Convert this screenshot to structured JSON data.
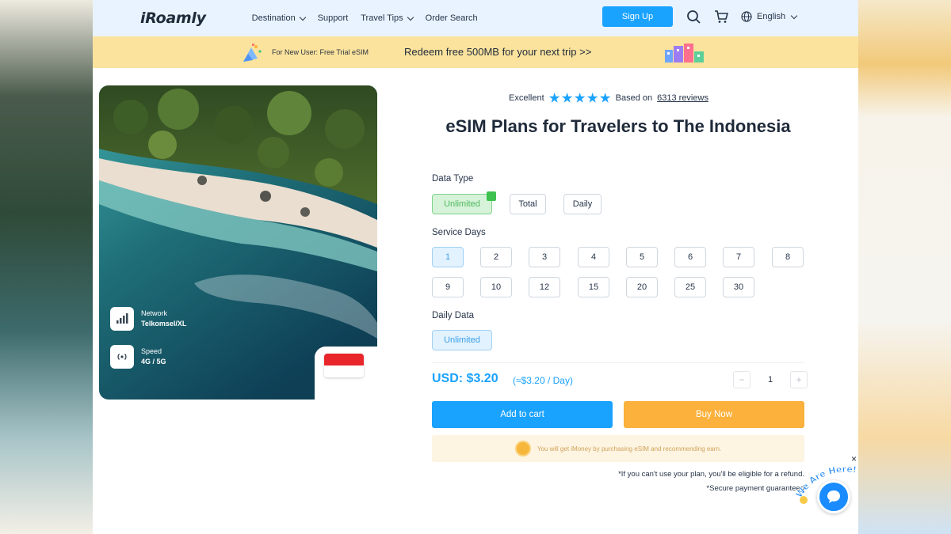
{
  "header": {
    "logo": "iRoamly",
    "nav": [
      {
        "label": "Destination",
        "dropdown": true
      },
      {
        "label": "Support",
        "dropdown": false
      },
      {
        "label": "Travel Tips",
        "dropdown": true
      },
      {
        "label": "Order Search",
        "dropdown": false
      }
    ],
    "signup_label": "Sign Up",
    "language": "English"
  },
  "promo": {
    "small_text": "For New User: Free Trial eSIM",
    "big_text": "Redeem free 500MB for your next trip >>"
  },
  "hero": {
    "network_label": "Network",
    "network_value": "Telkomsel/XL",
    "speed_label": "Speed",
    "speed_value": "4G / 5G"
  },
  "rating": {
    "label": "Excellent",
    "based_on": "Based on",
    "reviews": "6313 reviews",
    "stars": 5
  },
  "title": "eSIM Plans for Travelers to The Indonesia",
  "data_type": {
    "label": "Data Type",
    "options": [
      "Unlimited",
      "Total",
      "Daily"
    ],
    "selected": "Unlimited"
  },
  "service_days": {
    "label": "Service Days",
    "row1": [
      "1",
      "2",
      "3",
      "4",
      "5",
      "6",
      "7",
      "8"
    ],
    "row2": [
      "9",
      "10",
      "12",
      "15",
      "20",
      "25",
      "30"
    ],
    "selected": "1"
  },
  "daily_data": {
    "label": "Daily Data",
    "options": [
      "Unlimited"
    ],
    "selected": "Unlimited"
  },
  "pricing": {
    "price": "USD: $3.20",
    "per_day": "(≈$3.20 / Day)",
    "quantity": "1",
    "minus": "−",
    "plus": "+"
  },
  "actions": {
    "add_to_cart": "Add to cart",
    "buy_now": "Buy Now"
  },
  "imoney_note": "You will get iMoney by purchasing eSIM and recommending earn.",
  "notes": {
    "refund": "*If you can't use your plan, you'll be eligible for a refund.",
    "secure": "*Secure payment guaranteed"
  },
  "chat": {
    "bubble_text": "We Are Here!",
    "close": "×"
  },
  "colors": {
    "accent": "#1aa2ff",
    "buy": "#fbb13c",
    "promo_bg": "#fbe39d",
    "header_bg": "#e8f3ff",
    "selected_green": "#d6f3d9",
    "selected_blue": "#e3f2ff"
  }
}
